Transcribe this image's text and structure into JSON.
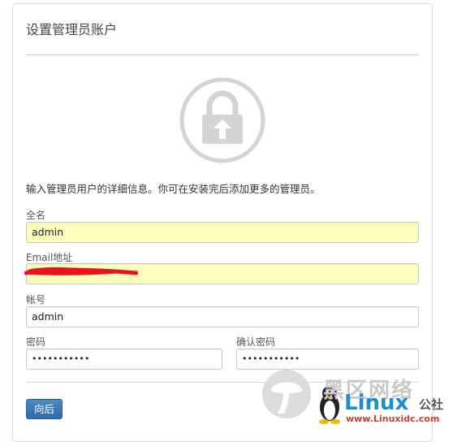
{
  "page": {
    "title": "设置管理员账户",
    "intro": "输入管理员用户的详细信息。你可在安装完后添加更多的管理员。"
  },
  "form": {
    "fullname": {
      "label": "全名",
      "value": "admin"
    },
    "email": {
      "label": "Email地址",
      "value": ""
    },
    "username": {
      "label": "帐号",
      "value": "admin"
    },
    "password": {
      "label": "密码",
      "value": "•••••••••••"
    },
    "confirm_password": {
      "label": "确认密码",
      "value": "•••••••••••"
    }
  },
  "actions": {
    "next_label": "向后"
  },
  "watermark": {
    "cn_text": "黑区网络",
    "brand": "Linux",
    "brand_suffix": "公社",
    "url": "www.Linuxidc.com"
  },
  "colors": {
    "autofill_bg": "#faffbd",
    "button_blue": "#3a78b8",
    "redaction_red": "#e8141c",
    "icon_gray": "#d4d4d4"
  },
  "icons": {
    "lock": "lock-upload-icon",
    "penguin": "penguin-icon",
    "mushroom": "mushroom-logo-icon"
  }
}
